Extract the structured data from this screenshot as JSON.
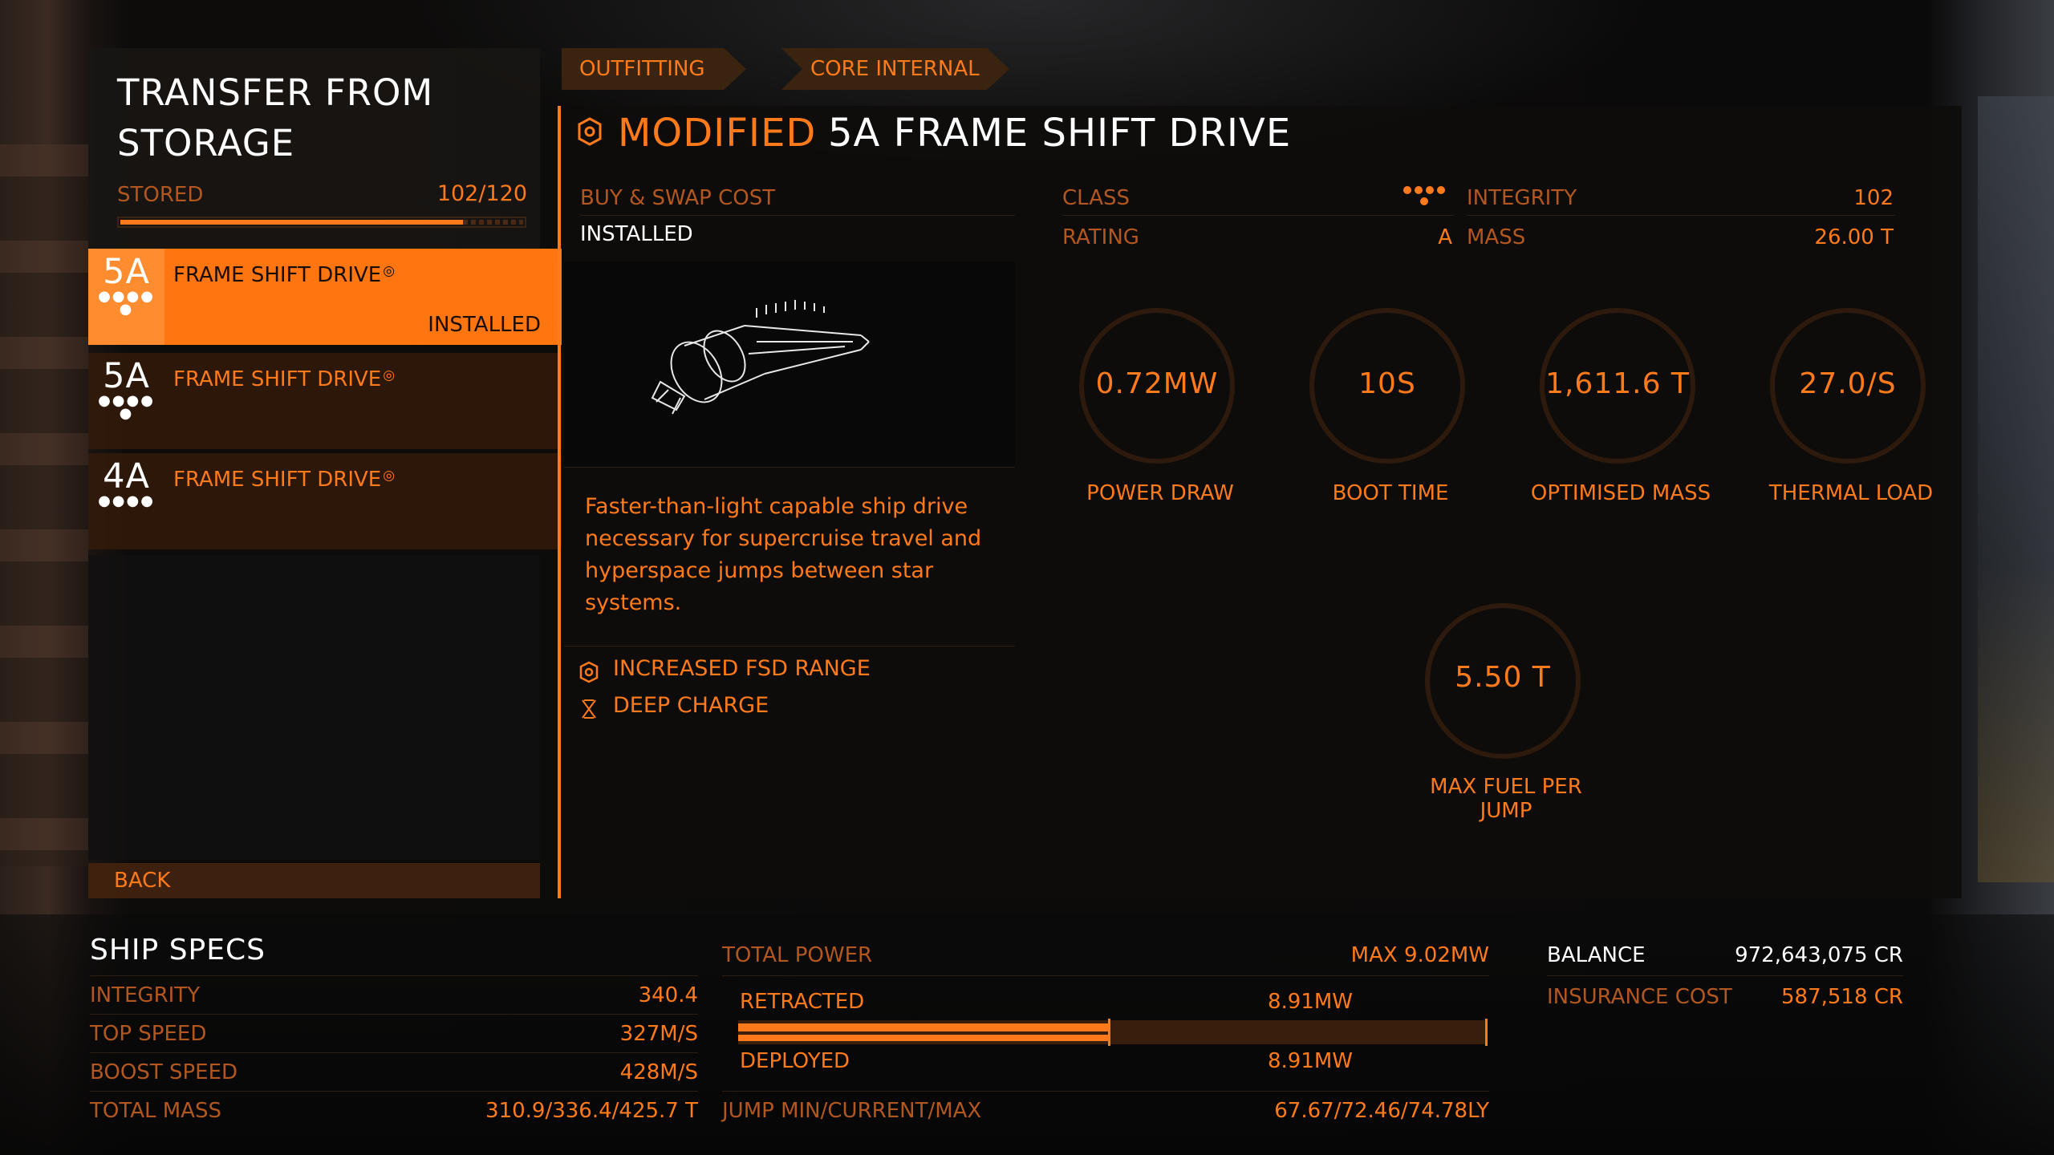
{
  "left_panel": {
    "title": "TRANSFER FROM STORAGE",
    "stored_label": "STORED",
    "stored_value": "102/120",
    "stored_fraction": 0.85,
    "items": [
      {
        "class": "5A",
        "name": "FRAME SHIFT DRIVE",
        "status": "INSTALLED",
        "selected": true
      },
      {
        "class": "5A",
        "name": "FRAME SHIFT DRIVE",
        "status": "",
        "selected": false
      },
      {
        "class": "4A",
        "name": "FRAME SHIFT DRIVE",
        "status": "",
        "selected": false
      }
    ],
    "back_label": "BACK"
  },
  "breadcrumbs": [
    "OUTFITTING",
    "CORE INTERNAL"
  ],
  "module": {
    "modified_label": "MODIFIED",
    "title": "5A FRAME SHIFT DRIVE",
    "buy_swap_label": "BUY & SWAP COST",
    "buy_swap_value": "INSTALLED",
    "class_label": "CLASS",
    "rating_label": "RATING",
    "rating_value": "A",
    "integrity_label": "INTEGRITY",
    "integrity_value": "102",
    "mass_label": "MASS",
    "mass_value": "26.00 T",
    "description": "Faster-than-light capable ship drive necessary for supercruise travel and hyperspace jumps between star systems.",
    "engineering": [
      {
        "icon": "blueprint-icon",
        "label": "INCREASED FSD RANGE"
      },
      {
        "icon": "experimental-effect-icon",
        "label": "DEEP CHARGE"
      }
    ],
    "gauges": [
      {
        "value": "0.72MW",
        "label": "POWER DRAW"
      },
      {
        "value": "10S",
        "label": "BOOT TIME"
      },
      {
        "value": "1,611.6 T",
        "label": "OPTIMISED MASS"
      },
      {
        "value": "27.0/S",
        "label": "THERMAL LOAD"
      },
      {
        "value": "5.50 T",
        "label": "MAX FUEL PER JUMP"
      }
    ]
  },
  "ship_specs": {
    "title": "SHIP SPECS",
    "rows": [
      {
        "label": "INTEGRITY",
        "value": "340.4"
      },
      {
        "label": "TOP SPEED",
        "value": "327M/S"
      },
      {
        "label": "BOOST SPEED",
        "value": "428M/S"
      },
      {
        "label": "TOTAL MASS",
        "value": "310.9/336.4/425.7 T"
      }
    ]
  },
  "power": {
    "total_label": "TOTAL POWER",
    "max_value": "MAX 9.02MW",
    "retracted_label": "RETRACTED",
    "retracted_value": "8.91MW",
    "deployed_label": "DEPLOYED",
    "deployed_value": "8.91MW",
    "retracted_fraction": 0.988,
    "jump_label": "JUMP MIN/CURRENT/MAX",
    "jump_value": "67.67/72.46/74.78LY"
  },
  "finance": {
    "balance_label": "BALANCE",
    "balance_value": "972,643,075 CR",
    "insurance_label": "INSURANCE COST",
    "insurance_value": "587,518 CR"
  },
  "colors": {
    "accent": "#ff7a1a",
    "dim": "#b2571f",
    "text_white": "#ffffff",
    "selected_bg": "#ff7510"
  }
}
